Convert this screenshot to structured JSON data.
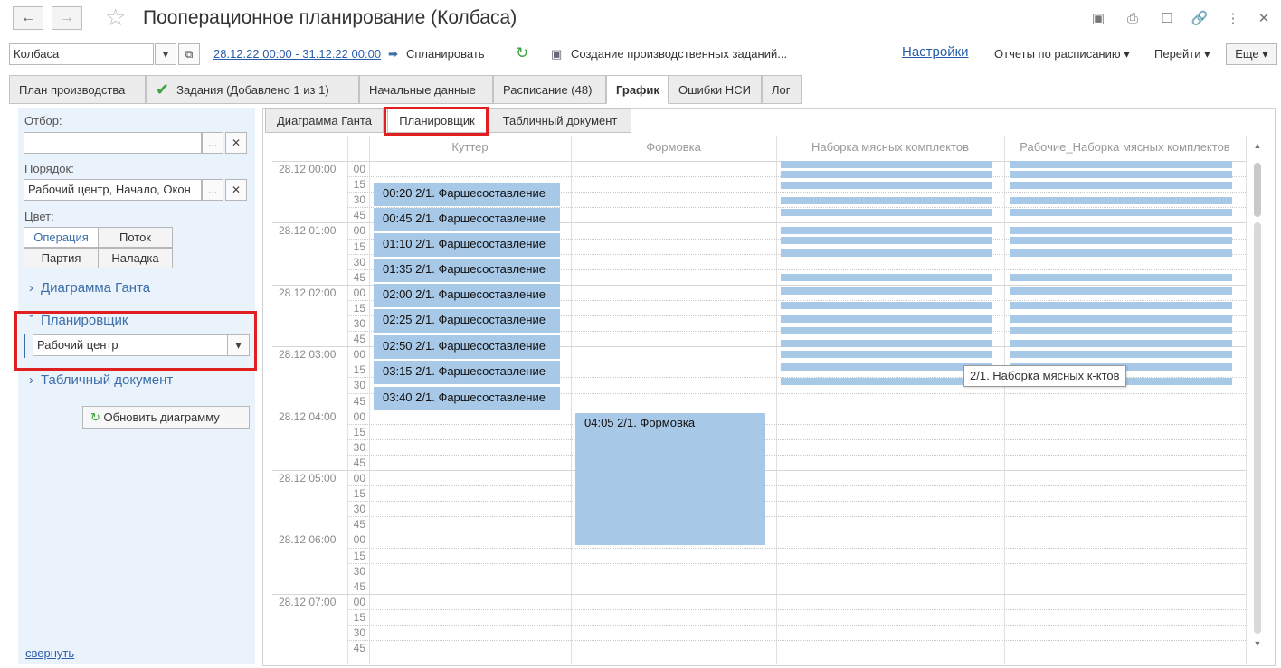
{
  "window": {
    "title": "Пооперационное планирование (Колбаса)"
  },
  "command_bar": {
    "product_value": "Колбаса",
    "period_link": "28.12.22 00:00 - 31.12.22 00:00",
    "plan_button": "Спланировать",
    "create_tasks_button": "Создание производственных заданий...",
    "settings_link": "Настройки",
    "scheduled_reports": "Отчеты по расписанию",
    "goto": "Перейти",
    "more": "Еще"
  },
  "tabs": [
    {
      "label": "План производства"
    },
    {
      "label": "Задания (Добавлено 1 из 1)"
    },
    {
      "label": "Начальные данные"
    },
    {
      "label": "Расписание (48)"
    },
    {
      "label": "График"
    },
    {
      "label": "Ошибки НСИ"
    },
    {
      "label": "Лог"
    }
  ],
  "left_panel": {
    "filter_label": "Отбор:",
    "filter_value": "",
    "order_label": "Порядок:",
    "order_value": "Рабочий центр, Начало, Окон",
    "color_label": "Цвет:",
    "color_options": [
      "Операция",
      "Поток",
      "Партия",
      "Наладка"
    ],
    "group_gantt": "Диаграмма Ганта",
    "group_planner": "Планировщик",
    "planner_select": "Рабочий центр",
    "group_table": "Табличный документ",
    "refresh_button": "Обновить диаграмму",
    "collapse_link": "свернуть"
  },
  "subtabs": [
    "Диаграмма Ганта",
    "Планировщик",
    "Табличный документ"
  ],
  "planner": {
    "columns": [
      "Куттер",
      "Формовка",
      "Наборка мясных комплектов",
      "Рабочие_Наборка мясных комплектов"
    ],
    "hours": [
      "28.12 00:00",
      "28.12 01:00",
      "28.12 02:00",
      "28.12 03:00",
      "28.12 04:00",
      "28.12 05:00",
      "28.12 06:00",
      "28.12 07:00"
    ],
    "minutes": [
      "00",
      "15",
      "30",
      "45"
    ],
    "cutter_blocks": [
      "00:20 2/1. Фаршесоставление",
      "00:45 2/1. Фаршесоставление",
      "01:10 2/1. Фаршесоставление",
      "01:35 2/1. Фаршесоставление",
      "02:00 2/1. Фаршесоставление",
      "02:25 2/1. Фаршесоставление",
      "02:50 2/1. Фаршесоставление",
      "03:15 2/1. Фаршесоставление",
      "03:40 2/1. Фаршесоставление"
    ],
    "forming_block": "04:05 2/1. Формовка",
    "tooltip": "2/1. Наборка мясных к-ктов"
  },
  "colors": {
    "block": "#a7c8e6",
    "accent": "#3c6ea8",
    "highlight": "#e02020"
  }
}
